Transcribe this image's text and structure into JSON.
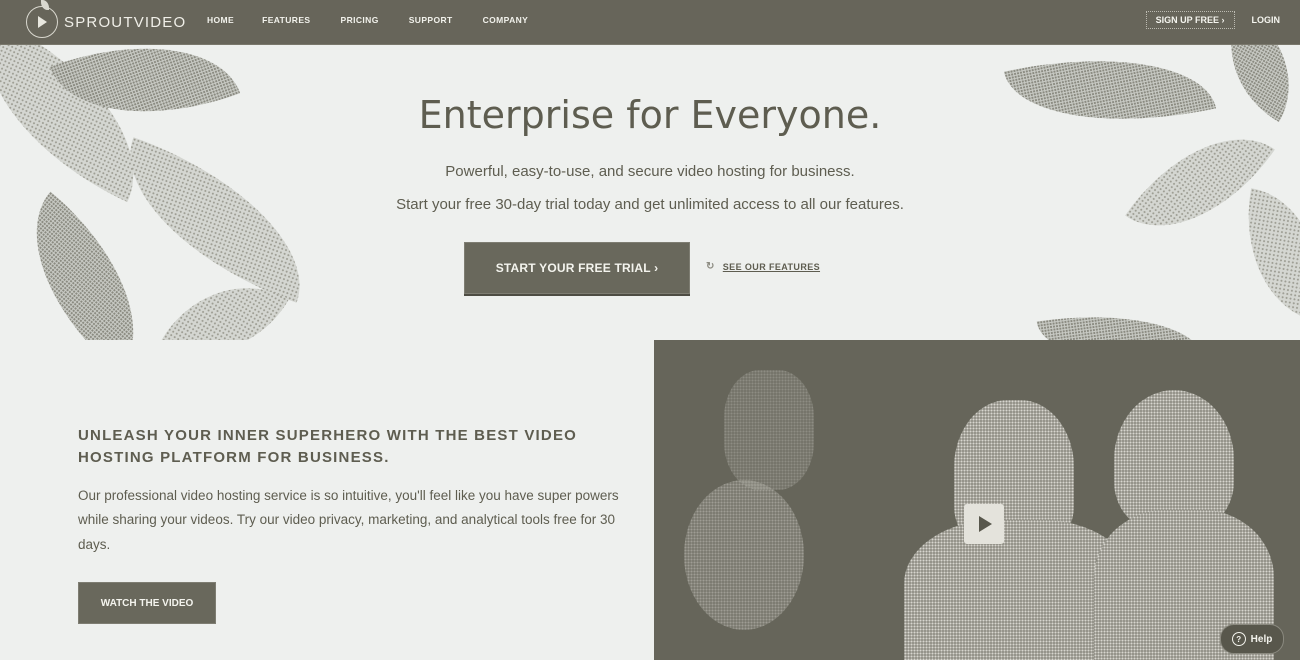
{
  "brand": {
    "name": "SPROUTVIDEO"
  },
  "nav": {
    "links": [
      "HOME",
      "FEATURES",
      "PRICING",
      "SUPPORT",
      "COMPANY"
    ],
    "signup": "SIGN UP FREE ›",
    "login": "LOGIN"
  },
  "hero": {
    "title": "Enterprise for Everyone.",
    "subtitle1": "Powerful, easy-to-use, and secure video hosting for business.",
    "subtitle2": "Start your free 30-day trial today and get unlimited access to all our features.",
    "cta": "START YOUR FREE TRIAL ›",
    "features_link": "SEE OUR FEATURES",
    "features_icon": "↻"
  },
  "section": {
    "title": "UNLEASH YOUR INNER SUPERHERO WITH THE BEST VIDEO HOSTING PLATFORM FOR BUSINESS.",
    "body": "Our professional video hosting service is so intuitive, you'll feel like you have super powers while sharing your videos. Try our video privacy, marketing, and analytical tools free for 30 days.",
    "button": "WATCH THE VIDEO"
  },
  "help": {
    "label": "Help",
    "icon": "?"
  },
  "colors": {
    "nav_bg": "#67655a",
    "page_bg": "#eef0ee",
    "button_bg": "#69685c",
    "text": "#5e5d50"
  }
}
